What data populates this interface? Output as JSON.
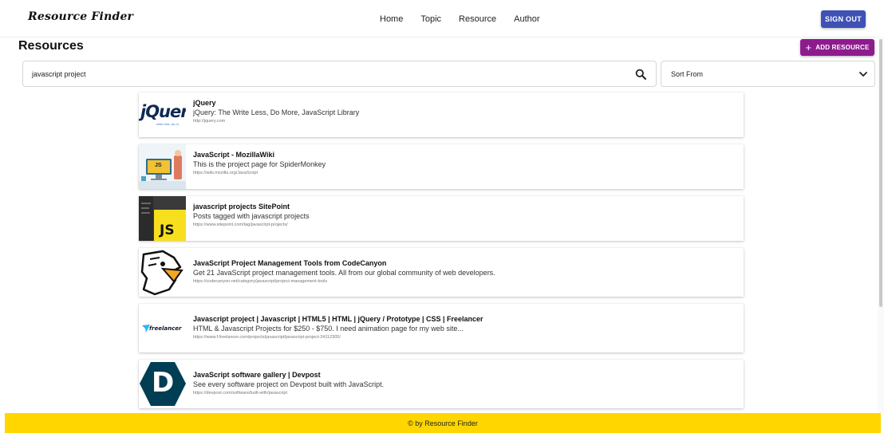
{
  "header": {
    "brand": "Resource Finder",
    "nav": [
      {
        "label": "Home"
      },
      {
        "label": "Topic"
      },
      {
        "label": "Resource"
      },
      {
        "label": "Author"
      }
    ],
    "sign_out": "SIGN OUT"
  },
  "page": {
    "title": "Resources",
    "add_button": "ADD RESOURCE",
    "add_icon": "+"
  },
  "search": {
    "value": "javascript project",
    "icon": "search-icon"
  },
  "sort": {
    "selected": "Sort From",
    "icon": "chevron-down-icon"
  },
  "results": [
    {
      "title": "jQuery",
      "description": "jQuery: The Write Less, Do More, JavaScript Library",
      "url": "http://jquery.com",
      "logo_text": "jQuer",
      "logo_tagline": "write less, do m"
    },
    {
      "title": "JavaScript - MozillaWiki",
      "description": "This is the project page for SpiderMonkey",
      "url": "https://wiki.mozilla.org/JavaScript",
      "logo_text": "JS"
    },
    {
      "title": "javascript projects SitePoint",
      "description": "Posts tagged with javascript projects",
      "url": "https://www.sitepoint.com/tag/javascript-projects/",
      "logo_text": "JS"
    },
    {
      "title": "JavaScript Project Management Tools from CodeCanyon",
      "description": "Get 21 JavaScript project management tools. All from our global community of web developers.",
      "url": "https://codecanyon.net/category/javascript/project-management-tools"
    },
    {
      "title": "Javascript project | Javascript | HTML5 | HTML | jQuery / Prototype | CSS | Freelancer",
      "description": "HTML & Javascript Projects for $250 - $750. I need animation page for my web site...",
      "url": "https://www.f.freelancer.com/projects/javascript/javascript-project-24112305/",
      "logo_text": "freelancer"
    },
    {
      "title": "JavaScript software gallery | Devpost",
      "description": "See every software project on Devpost built with JavaScript.",
      "url": "https://devpost.com/software/built-with/javascript",
      "logo_text": "D"
    }
  ],
  "footer": {
    "text": "© by Resource Finder"
  },
  "colors": {
    "sign_out_bg": "#3f51b5",
    "add_resource_bg": "#8e1b8e",
    "footer_bg": "#ffd600"
  }
}
